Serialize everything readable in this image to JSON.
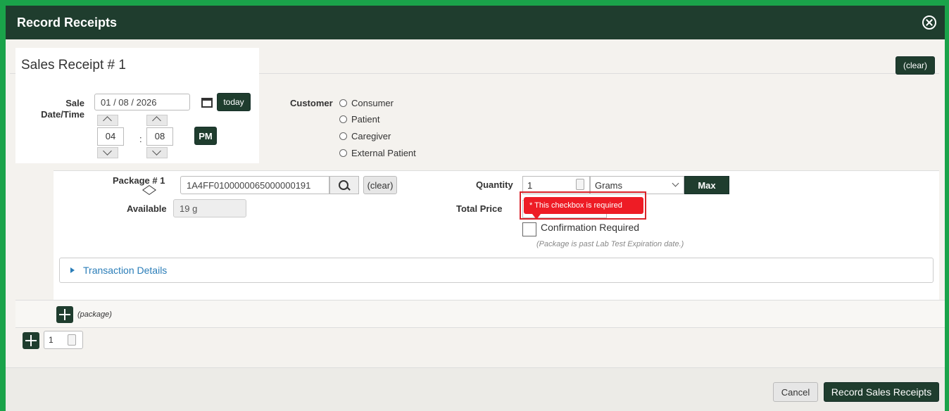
{
  "dialog": {
    "title": "Record Receipts"
  },
  "receipt": {
    "title": "Sales Receipt # 1",
    "clear_label": "(clear)"
  },
  "sale": {
    "label": "Sale Date/Time",
    "date": "01 / 08 / 2026",
    "today_label": "today",
    "hour": "04",
    "minute": "08",
    "separator": ":",
    "ampm": "PM"
  },
  "customer": {
    "label": "Customer",
    "options": [
      "Consumer",
      "Patient",
      "Caregiver",
      "External Patient"
    ]
  },
  "package": {
    "label": "Package # 1",
    "tag": "1A4FF0100000065000000191",
    "clear_label": "(clear)",
    "available_label": "Available",
    "available_value": "19 g",
    "quantity_label": "Quantity",
    "quantity_value": "1",
    "unit": "Grams",
    "max_label": "Max",
    "total_price_label": "Total Price",
    "error_tooltip": "* This checkbox is required",
    "confirm_label": "Confirmation Required",
    "note": "(Package is past Lab Test Expiration date.)"
  },
  "transaction": {
    "label": "Transaction Details"
  },
  "add_package": {
    "hint": "(package)"
  },
  "receipt_count": {
    "value": "1"
  },
  "footer": {
    "cancel_label": "Cancel",
    "record_label": "Record Sales Receipts"
  },
  "colors": {
    "header": "#1f3d2e",
    "accent": "#1aa34a",
    "error": "#ee1c25",
    "link": "#2a7db8"
  }
}
